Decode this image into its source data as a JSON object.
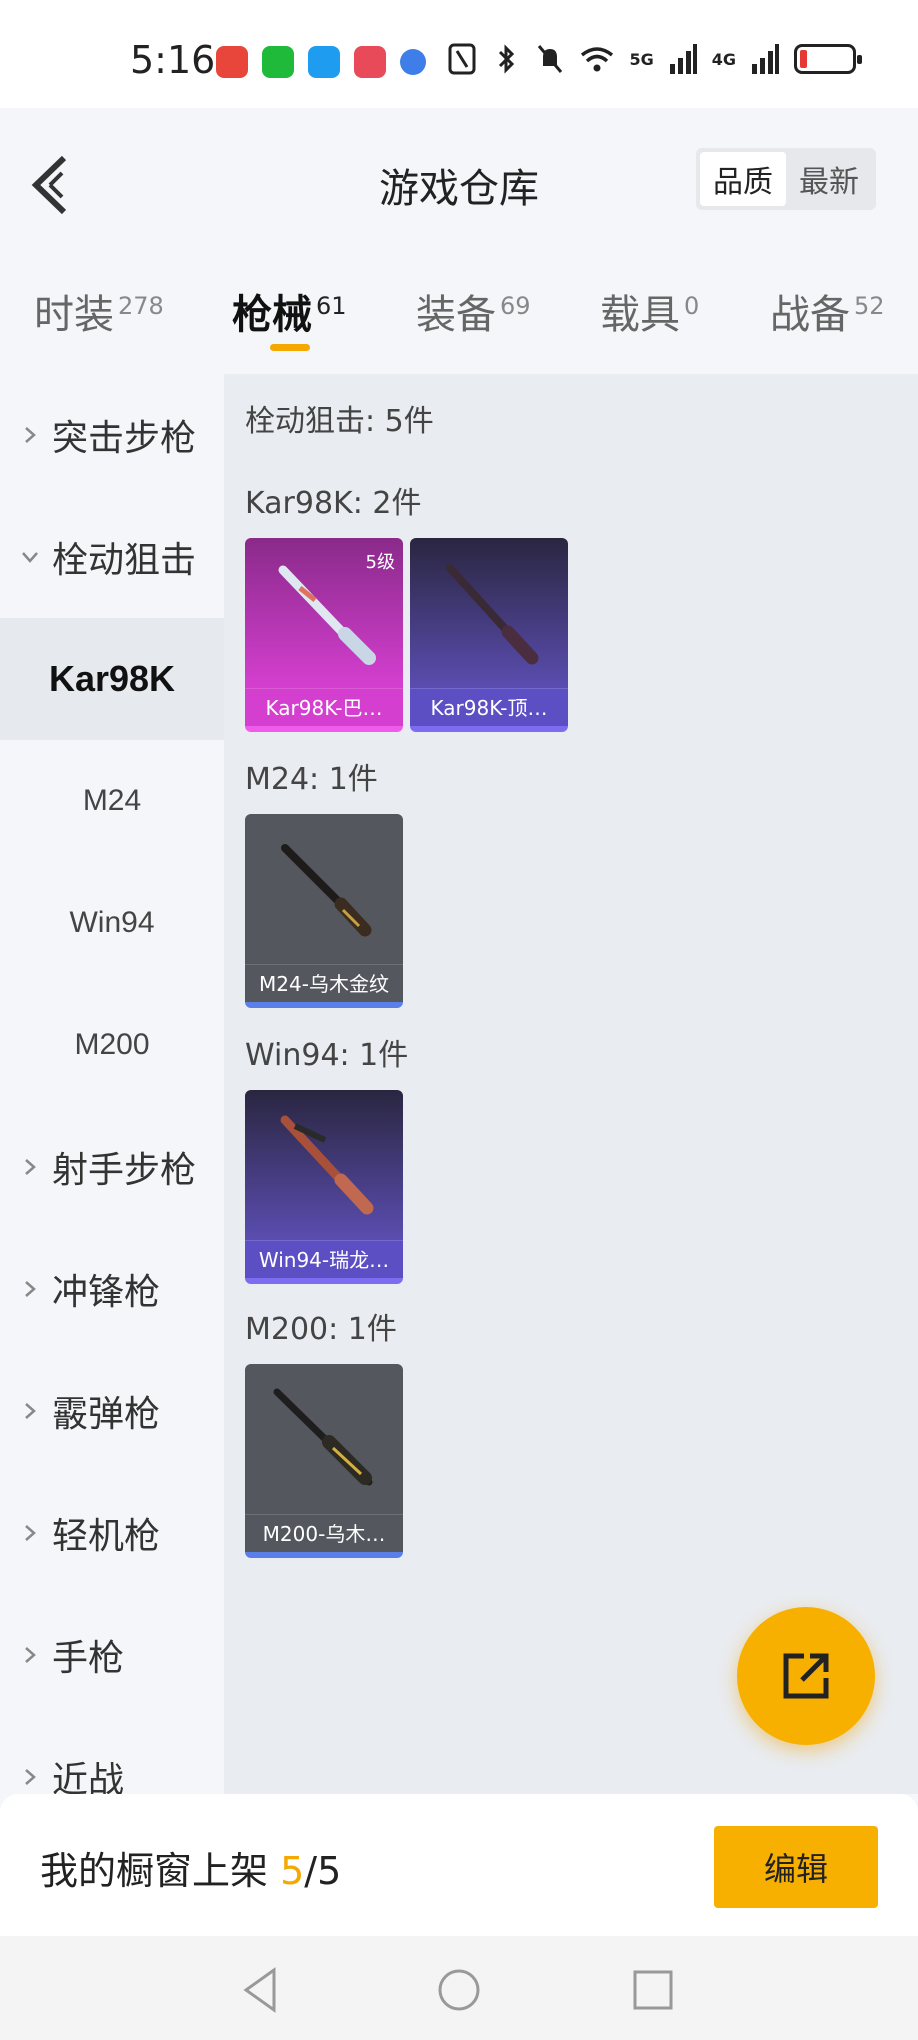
{
  "status": {
    "time": "5:16",
    "net1": "5G",
    "net2": "4G"
  },
  "header": {
    "title": "游戏仓库",
    "sort_options": [
      "品质",
      "最新"
    ],
    "sort_active": "品质"
  },
  "tabs": [
    {
      "label": "时装",
      "count": "278"
    },
    {
      "label": "枪械",
      "count": "61"
    },
    {
      "label": "装备",
      "count": "69"
    },
    {
      "label": "载具",
      "count": "0"
    },
    {
      "label": "战备",
      "count": "52"
    }
  ],
  "sidebar": {
    "items": [
      {
        "label": "突击步枪"
      },
      {
        "label": "栓动狙击"
      },
      {
        "label": "Kar98K"
      },
      {
        "label": "M24"
      },
      {
        "label": "Win94"
      },
      {
        "label": "M200"
      },
      {
        "label": "射手步枪"
      },
      {
        "label": "冲锋枪"
      },
      {
        "label": "霰弹枪"
      },
      {
        "label": "轻机枪"
      },
      {
        "label": "手枪"
      },
      {
        "label": "近战"
      }
    ]
  },
  "content": {
    "category_title": "栓动狙击: 5件",
    "groups": [
      {
        "title": "Kar98K: 2件",
        "items": [
          {
            "name": "Kar98K-巴…",
            "level": "5级"
          },
          {
            "name": "Kar98K-顶…"
          }
        ]
      },
      {
        "title": "M24: 1件",
        "items": [
          {
            "name": "M24-乌木金纹"
          }
        ]
      },
      {
        "title": "Win94: 1件",
        "items": [
          {
            "name": "Win94-瑞龙…"
          }
        ]
      },
      {
        "title": "M200: 1件",
        "items": [
          {
            "name": "M200-乌木…"
          }
        ]
      }
    ]
  },
  "bottom": {
    "shelf_label": "我的橱窗上架",
    "shelf_current": "5",
    "shelf_total": "/5",
    "edit_label": "编辑"
  },
  "colors": {
    "accent": "#f7b000",
    "rarity_pink": "#d53fd0",
    "rarity_purple": "#6e5fd8",
    "rarity_blue": "#5b7fe8"
  }
}
